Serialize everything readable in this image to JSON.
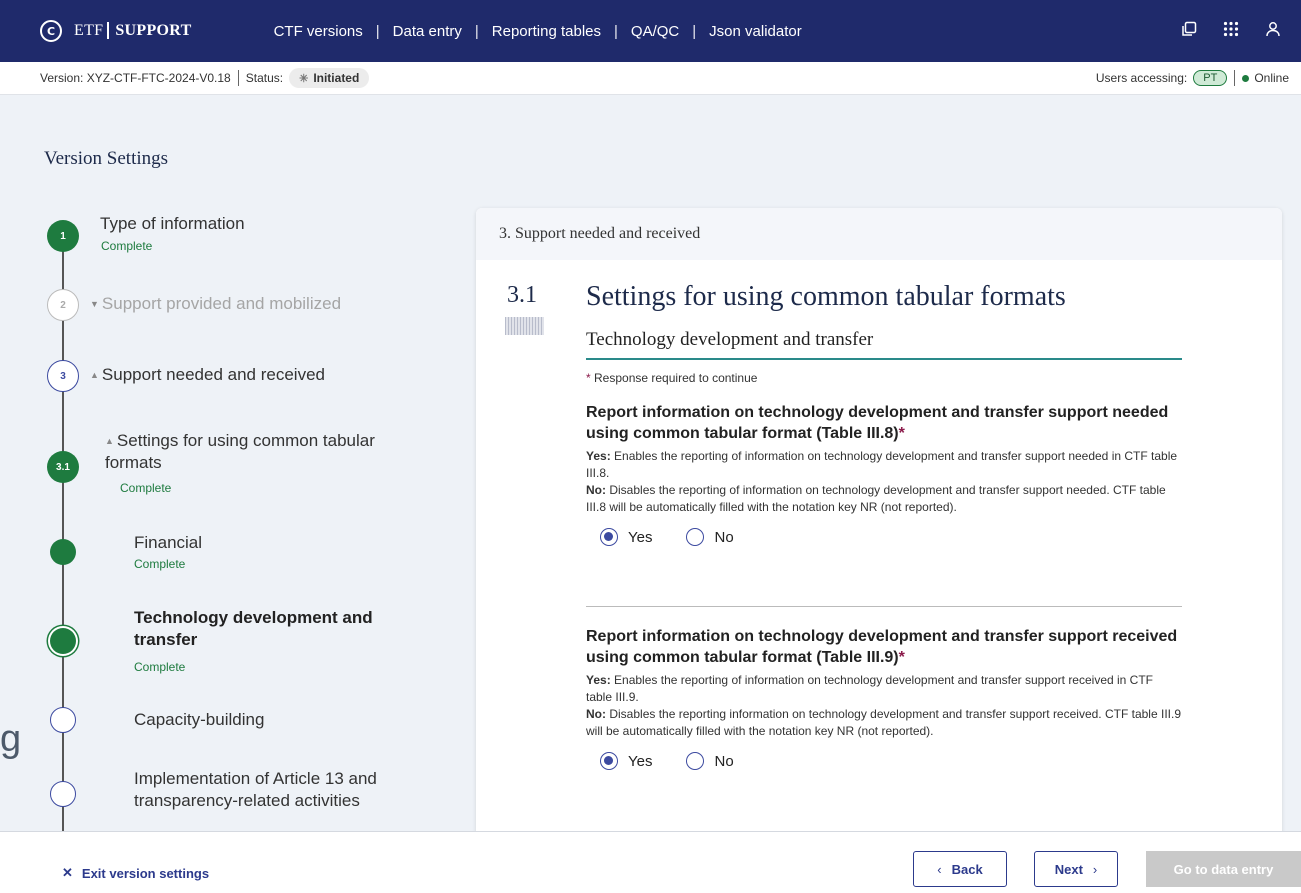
{
  "header": {
    "logo_symbol": "C",
    "brand_prefix": "ETF",
    "brand_name": "SUPPORT",
    "nav": [
      "CTF versions",
      "Data entry",
      "Reporting tables",
      "QA/QC",
      "Json validator"
    ],
    "nav_separator": "|",
    "icons": [
      "copy-icon",
      "apps-grid-icon",
      "user-icon"
    ]
  },
  "statusbar": {
    "version": "Version: XYZ-CTF-FTC-2024-V0.18",
    "status_label": "Status:",
    "status_value": "Initiated",
    "users_label": "Users accessing:",
    "user_initials": "PT",
    "online_label": "Online"
  },
  "page_title": "Version Settings",
  "stepper": {
    "steps": [
      {
        "num": "1",
        "label": "Type of information",
        "status": "Complete"
      },
      {
        "num": "2",
        "label": "Support provided and mobilized"
      },
      {
        "num": "3",
        "label": "Support needed and received"
      },
      {
        "num": "3.1",
        "label": "Settings for using common tabular formats",
        "status": "Complete"
      },
      {
        "label": "Financial",
        "status": "Complete"
      },
      {
        "label": "Technology development and transfer",
        "status": "Complete"
      },
      {
        "label": "Capacity-building"
      },
      {
        "label": "Implementation of Article 13 and transparency-related activities"
      }
    ],
    "ghost_char": "g"
  },
  "card": {
    "header": "3. Support needed and received",
    "section_number": "3.1",
    "section_title": "Settings for using common tabular formats",
    "section_subtitle": "Technology development and transfer",
    "required_note": "Response required to continue",
    "questions": [
      {
        "title": "Report information on technology development and transfer support needed using common tabular format (Table III.8)",
        "yes_label": "Yes:",
        "yes_text": "Enables the reporting of information on technology development and transfer support needed in CTF table III.8.",
        "no_label": "No:",
        "no_text": "Disables the reporting of information on technology development and transfer support needed. CTF table III.8 will be automatically filled with the notation key NR (not reported).",
        "options": [
          "Yes",
          "No"
        ],
        "selected": "Yes"
      },
      {
        "title": "Report information on technology development and transfer support received using common tabular format (Table III.9)",
        "yes_label": "Yes:",
        "yes_text": "Enables the reporting of information on technology development and transfer support received in CTF table III.9.",
        "no_label": "No:",
        "no_text": "Disables the reporting information on technology development and transfer support received. CTF table III.9 will be automatically filled with the notation key NR (not reported).",
        "options": [
          "Yes",
          "No"
        ],
        "selected": "Yes"
      }
    ]
  },
  "footer": {
    "exit_label": "Exit version settings",
    "back_label": "Back",
    "next_label": "Next",
    "go_label": "Go to data entry"
  },
  "colors": {
    "nav_bg": "#1f2a6b",
    "complete_green": "#1e7b3f",
    "primary_blue": "#2c3a8c",
    "required_asterisk": "#8b1a4a",
    "disabled_button": "#c9c9c9"
  }
}
